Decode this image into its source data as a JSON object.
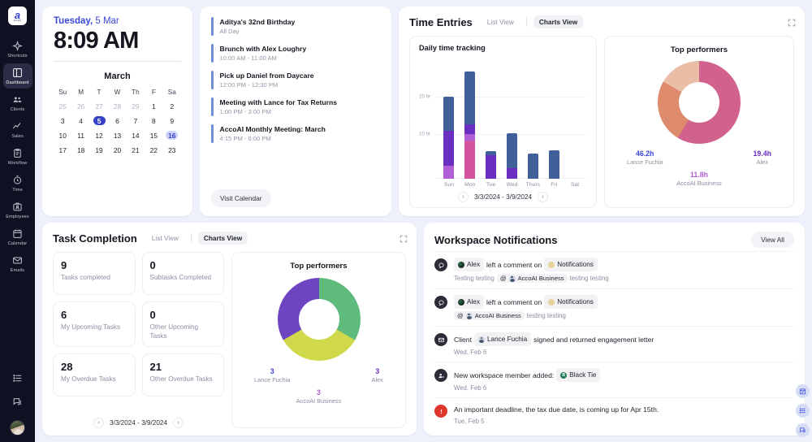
{
  "sidebar": {
    "logo": {
      "letter": "a",
      "sub": "AccoAI"
    },
    "items": [
      {
        "label": "Shortcuts",
        "icon": "sparkle-icon",
        "active": false
      },
      {
        "label": "Dashboard",
        "icon": "dashboard-icon",
        "active": true
      },
      {
        "label": "Clients",
        "icon": "clients-icon",
        "active": false
      },
      {
        "label": "Sales",
        "icon": "sales-trend-icon",
        "active": false
      },
      {
        "label": "Workflow",
        "icon": "workflow-clipboard-icon",
        "active": false
      },
      {
        "label": "Time",
        "icon": "timer-icon",
        "active": false
      },
      {
        "label": "Employees",
        "icon": "employees-badge-icon",
        "active": false
      },
      {
        "label": "Calendar",
        "icon": "calendar-icon",
        "active": false
      },
      {
        "label": "Emails",
        "icon": "envelope-icon",
        "active": false
      }
    ],
    "bottom_icons": [
      "list-icon",
      "chat-icon",
      "user-avatar"
    ]
  },
  "clock": {
    "day_of_week": "Tuesday,",
    "day_month": " 5 Mar",
    "time": "8:09 AM"
  },
  "calendar": {
    "month": "March",
    "weekday_headers": [
      "Su",
      "M",
      "T",
      "W",
      "Th",
      "F",
      "Sa"
    ],
    "weeks": [
      [
        {
          "d": "25",
          "muted": true
        },
        {
          "d": "26",
          "muted": true
        },
        {
          "d": "27",
          "muted": true
        },
        {
          "d": "28",
          "muted": true
        },
        {
          "d": "29",
          "muted": true
        },
        {
          "d": "1"
        },
        {
          "d": "2"
        }
      ],
      [
        {
          "d": "3"
        },
        {
          "d": "4"
        },
        {
          "d": "5",
          "selected": true
        },
        {
          "d": "6"
        },
        {
          "d": "7"
        },
        {
          "d": "8"
        },
        {
          "d": "9"
        }
      ],
      [
        {
          "d": "10"
        },
        {
          "d": "11"
        },
        {
          "d": "12"
        },
        {
          "d": "13"
        },
        {
          "d": "14"
        },
        {
          "d": "15"
        },
        {
          "d": "16",
          "highlight": true
        }
      ],
      [
        {
          "d": "17"
        },
        {
          "d": "18"
        },
        {
          "d": "19"
        },
        {
          "d": "20"
        },
        {
          "d": "21"
        },
        {
          "d": "22"
        },
        {
          "d": "23"
        }
      ]
    ]
  },
  "events": {
    "items": [
      {
        "title": "Aditya's 32nd Birthday",
        "time": "All Day"
      },
      {
        "title": "Brunch with Alex Loughry",
        "time": "10:00 AM - 11:00 AM"
      },
      {
        "title": "Pick up Daniel from Daycare",
        "time": "12:00 PM - 12:30 PM"
      },
      {
        "title": "Meeting with Lance for Tax Returns",
        "time": "1:00 PM - 3:00 PM"
      },
      {
        "title": "AccoAI Monthly Meeting: March",
        "time": "4:15 PM - 6:00 PM"
      }
    ],
    "visit_button": "Visit Calendar"
  },
  "time_entries": {
    "title": "Time Entries",
    "list_view": "List View",
    "charts_view": "Charts View",
    "expand_icon": "expand-icon",
    "date_range": "3/3/2024 - 3/9/2024",
    "prev": "‹",
    "next": "›"
  },
  "task_completion": {
    "title": "Task Completion",
    "list_view": "List View",
    "charts_view": "Charts View",
    "expand_icon": "expand-icon",
    "date_range": "3/3/2024 - 3/9/2024",
    "prev": "‹",
    "next": "›",
    "stats": [
      {
        "value": "9",
        "label": "Tasks completed"
      },
      {
        "value": "0",
        "label": "Subtasks Completed"
      },
      {
        "value": "6",
        "label": "My Upcoming Tasks"
      },
      {
        "value": "0",
        "label": "Other Upcoming Tasks"
      },
      {
        "value": "28",
        "label": "My Overdue Tasks"
      },
      {
        "value": "21",
        "label": "Other Overdue Tasks"
      }
    ]
  },
  "notifications": {
    "title": "Workspace Notifications",
    "view_all": "View All",
    "items": [
      {
        "icon": "comment-icon",
        "avatar": "alex",
        "actor": "Alex",
        "action": "left a comment on",
        "target_avatar": "tan",
        "target": "Notifications",
        "sub_prefix": "Testing testing",
        "sub_mention_at": "@",
        "sub_mention": "AccoAI Business",
        "sub_suffix": "testing testing"
      },
      {
        "icon": "comment-icon",
        "avatar": "alex",
        "actor": "Alex",
        "action": "left a comment on",
        "target_avatar": "tan",
        "target": "Notifications",
        "sub_prefix": "",
        "sub_mention_at": "@",
        "sub_mention": "AccoAI Business",
        "sub_suffix": "testing testing"
      },
      {
        "icon": "envelope-icon",
        "lead": "Client",
        "chip_avatar": "person",
        "chip": "Lance Fuchia",
        "tail": "signed and returned engagement letter",
        "date": "Wed, Feb 6"
      },
      {
        "icon": "member-add-icon",
        "lead": "New workspace member added:",
        "chip_avatar": "green",
        "chip_initial": "B",
        "chip": "Black Tie",
        "tail": "",
        "date": "Wed, Feb 6"
      },
      {
        "icon": "alert-icon",
        "alert": true,
        "lead": "An important deadline, the tax due date, is coming up for Apr 15th.",
        "date": "Tue, Feb 5"
      }
    ]
  },
  "fabs": [
    {
      "icon": "calendar-check-icon"
    },
    {
      "icon": "list-icon"
    },
    {
      "icon": "chat-icon"
    }
  ],
  "chart_data": [
    {
      "id": "daily-time-tracking",
      "type": "bar",
      "title": "Daily time tracking",
      "stacked": true,
      "categories": [
        "Sun",
        "Mon",
        "Tue",
        "Wed",
        "Thurs",
        "Fri",
        "Sat"
      ],
      "ylabel": "",
      "xlabel": "",
      "ylim": [
        0,
        26
      ],
      "yticks": [
        10,
        20
      ],
      "ytick_labels": [
        "10 hr",
        "20 hr"
      ],
      "grid": true,
      "legend": "none",
      "series": [
        {
          "name": "Segment A",
          "color": "#3f6099",
          "values": [
            7.5,
            11.5,
            0.9,
            7.5,
            5.5,
            6.3,
            0
          ]
        },
        {
          "name": "Segment B",
          "color": "#6a2fc0",
          "values": [
            7.6,
            2.2,
            5.1,
            2.4,
            0,
            0,
            0
          ]
        },
        {
          "name": "Segment C",
          "color": "#b05fd6",
          "values": [
            2.9,
            1.4,
            0,
            0,
            0,
            0,
            0
          ]
        },
        {
          "name": "Segment D",
          "color": "#d4559d",
          "values": [
            0,
            8.4,
            0,
            0,
            0,
            0,
            0
          ]
        }
      ],
      "totals": [
        18.0,
        23.5,
        6.0,
        9.9,
        5.5,
        6.3,
        0
      ]
    },
    {
      "id": "time-top-performers",
      "type": "pie",
      "title": "Top performers",
      "donut": true,
      "labels": [
        "Lance Fuchia",
        "Alex",
        "AccoAI Business"
      ],
      "values": [
        46.2,
        19.4,
        11.8
      ],
      "value_labels": [
        "46.2h",
        "19.4h",
        "11.8h"
      ],
      "colors": [
        "#d1628d",
        "#dd8a6d",
        "#e9bda6"
      ],
      "label_colors": [
        "#3b48d9",
        "#6a2fc0",
        "#b05fd6"
      ],
      "unit": "h"
    },
    {
      "id": "task-top-performers",
      "type": "pie",
      "title": "Top performers",
      "donut": true,
      "labels": [
        "Lance Fuchia",
        "Alex",
        "AccoAI Business"
      ],
      "values": [
        3,
        3,
        3
      ],
      "value_labels": [
        "3",
        "3",
        "3"
      ],
      "colors": [
        "#6f44c0",
        "#5fba7d",
        "#cfd94b"
      ],
      "label_colors": [
        "#3b48d9",
        "#6a2fc0",
        "#b05fd6"
      ],
      "unit": ""
    }
  ]
}
